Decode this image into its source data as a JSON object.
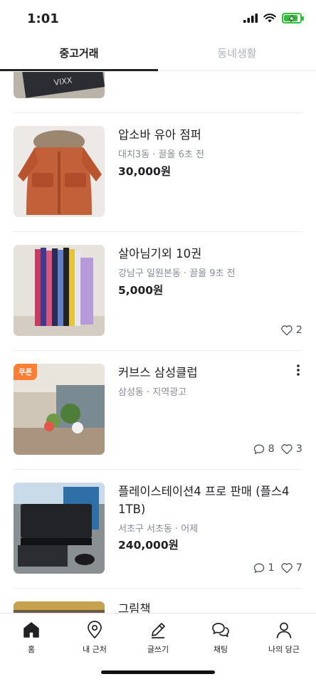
{
  "status": {
    "time": "1:01",
    "battery_level": 0.8,
    "accent": "#2fc13a"
  },
  "tabs": [
    {
      "label": "중고거래",
      "active": true
    },
    {
      "label": "동네생활",
      "active": false
    }
  ],
  "items": [
    {
      "thumb": "vixx-photo"
    },
    {
      "title": "압소바 유아 점퍼",
      "meta": "대치3동 · 끌올 6초 전",
      "price": "30,000원"
    },
    {
      "title": "살아님기외 10권",
      "meta": "강남구 일원본동 · 끌올 9초 전",
      "price": "5,000원",
      "likes": "2"
    },
    {
      "title": "커브스 삼성클럽",
      "meta": "삼성동 · 지역광고",
      "badge": "쿠폰",
      "comments": "8",
      "likes": "3"
    },
    {
      "title": "플레이스테이션4 프로 판매 (플스4 1TB)",
      "meta": "서초구 서초동 · 어제",
      "price": "240,000원",
      "comments": "1",
      "likes": "7"
    },
    {
      "title": "그림책"
    }
  ],
  "nav": [
    {
      "label": "홈",
      "icon": "home-icon",
      "active": true
    },
    {
      "label": "내 근처",
      "icon": "location-pin-icon"
    },
    {
      "label": "글쓰기",
      "icon": "pencil-icon"
    },
    {
      "label": "채팅",
      "icon": "chat-bubbles-icon"
    },
    {
      "label": "나의 당근",
      "icon": "person-icon"
    }
  ],
  "colors": {
    "brand": "#ff7e36",
    "text": "#212124",
    "sub": "#868b94"
  }
}
